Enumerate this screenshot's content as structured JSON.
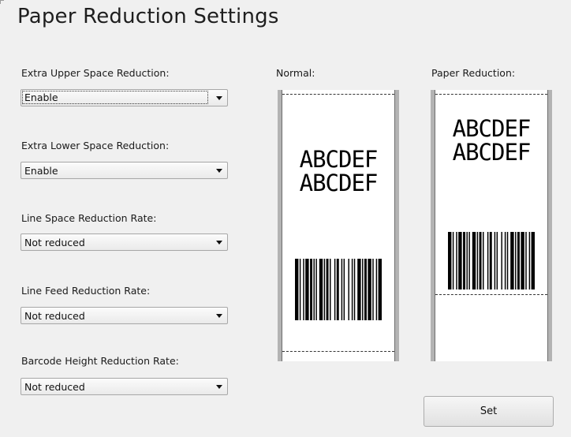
{
  "header": {
    "title": "Paper Reduction Settings"
  },
  "settings": [
    {
      "label": "Extra Upper Space Reduction:",
      "value": "Enable"
    },
    {
      "label": "Extra Lower Space Reduction:",
      "value": "Enable"
    },
    {
      "label": "Line Space Reduction Rate:",
      "value": "Not reduced"
    },
    {
      "label": "Line Feed Reduction Rate:",
      "value": "Not reduced"
    },
    {
      "label": "Barcode Height Reduction Rate:",
      "value": "Not reduced"
    }
  ],
  "preview": {
    "normal_label": "Normal:",
    "reduced_label": "Paper Reduction:",
    "sample_lines": [
      "ABCDEF",
      "ABCDEF"
    ]
  },
  "actions": {
    "set_label": "Set"
  }
}
